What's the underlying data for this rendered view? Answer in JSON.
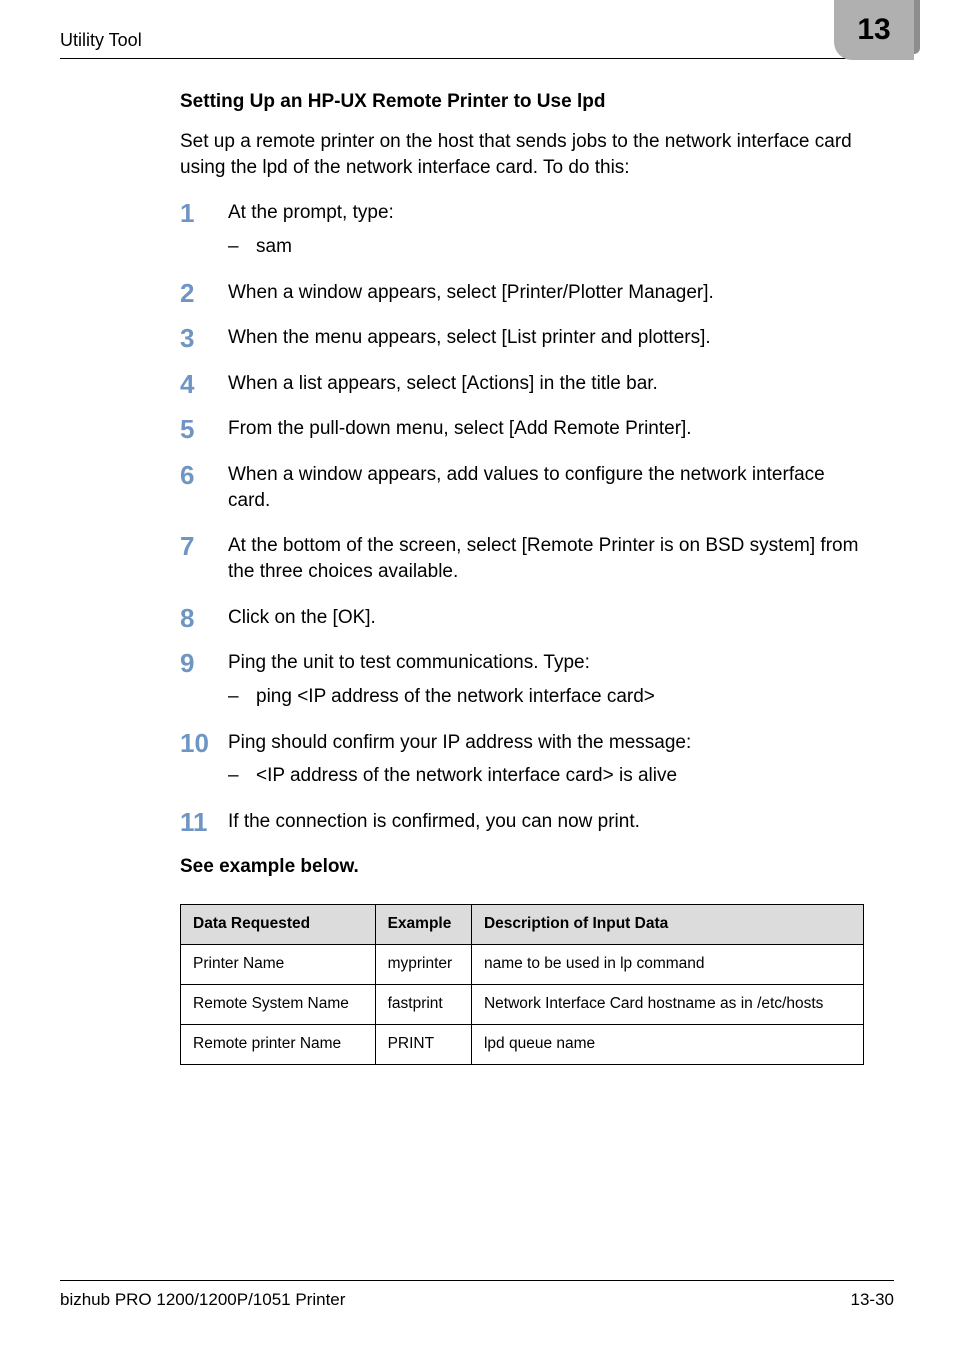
{
  "header": {
    "section": "Utility Tool",
    "chapter_number": "13"
  },
  "section_title": "Setting Up an HP-UX Remote Printer to Use lpd",
  "intro": "Set up a remote printer on the host that sends jobs to the network interface card using the lpd of the network interface card. To do this:",
  "steps": [
    {
      "n": "1",
      "text": "At the prompt, type:",
      "sub": [
        "sam"
      ]
    },
    {
      "n": "2",
      "text": "When a window appears, select [Printer/Plotter Manager]."
    },
    {
      "n": "3",
      "text": "When the menu appears, select [List printer and plotters]."
    },
    {
      "n": "4",
      "text": "When a list appears, select [Actions] in the title bar."
    },
    {
      "n": "5",
      "text": "From the pull-down menu, select [Add Remote Printer]."
    },
    {
      "n": "6",
      "text": "When a window appears, add values to configure the network interface card."
    },
    {
      "n": "7",
      "text": "At the bottom of the screen, select [Remote Printer is on BSD system] from the three choices available."
    },
    {
      "n": "8",
      "text": "Click on the [OK]."
    },
    {
      "n": "9",
      "text": "Ping the unit to test communications. Type:",
      "sub": [
        "ping <IP address of the network interface card>"
      ]
    },
    {
      "n": "10",
      "text": "Ping should confirm your IP address with the message:",
      "sub": [
        "<IP address of the network interface card> is alive"
      ]
    },
    {
      "n": "11",
      "text": "If the connection is confirmed, you can now print."
    }
  ],
  "see_example": "See example below.",
  "table": {
    "headers": [
      "Data Requested",
      "Example",
      "Description of Input Data"
    ],
    "rows": [
      [
        "Printer Name",
        "myprinter",
        "name to be used in lp command"
      ],
      [
        "Remote System Name",
        "fastprint",
        "Network Interface Card hostname as in /etc/hosts"
      ],
      [
        "Remote printer Name",
        "PRINT",
        "lpd queue name"
      ]
    ]
  },
  "footer": {
    "left": "bizhub PRO 1200/1200P/1051 Printer",
    "right": "13-30"
  }
}
